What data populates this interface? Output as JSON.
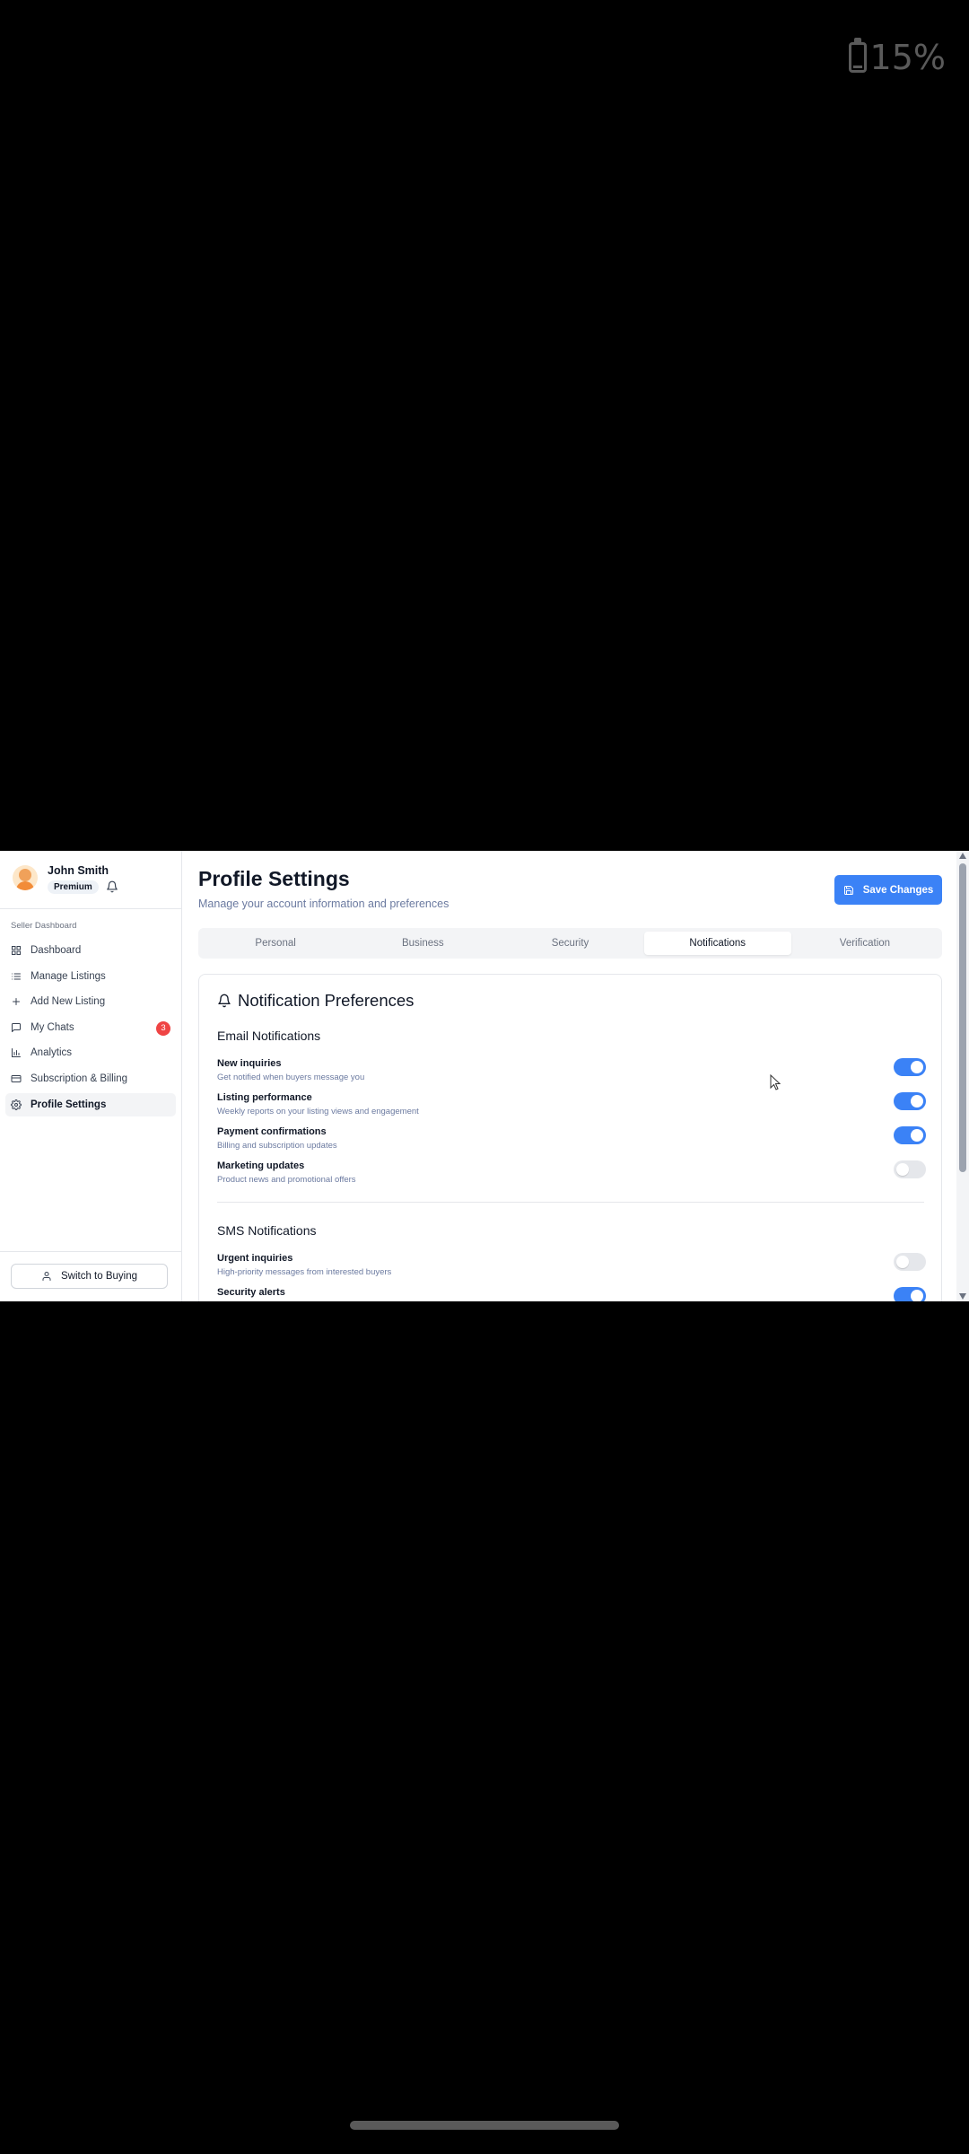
{
  "status_bar": {
    "battery_percent": "15%"
  },
  "user": {
    "name": "John Smith",
    "plan": "Premium"
  },
  "sidebar": {
    "section_label": "Seller Dashboard",
    "items": [
      {
        "label": "Dashboard",
        "icon": "grid-icon"
      },
      {
        "label": "Manage Listings",
        "icon": "list-icon"
      },
      {
        "label": "Add New Listing",
        "icon": "plus-icon"
      },
      {
        "label": "My Chats",
        "icon": "chat-icon",
        "badge": "3"
      },
      {
        "label": "Analytics",
        "icon": "bar-chart-icon"
      },
      {
        "label": "Subscription & Billing",
        "icon": "credit-card-icon"
      },
      {
        "label": "Profile Settings",
        "icon": "gear-icon",
        "active": true
      }
    ],
    "switch_label": "Switch to Buying"
  },
  "header": {
    "title": "Profile Settings",
    "subtitle": "Manage your account information and preferences",
    "save_label": "Save Changes"
  },
  "tabs": [
    {
      "label": "Personal"
    },
    {
      "label": "Business"
    },
    {
      "label": "Security"
    },
    {
      "label": "Notifications",
      "active": true
    },
    {
      "label": "Verification"
    }
  ],
  "notifications": {
    "title": "Notification Preferences",
    "email": {
      "title": "Email Notifications",
      "items": [
        {
          "label": "New inquiries",
          "desc": "Get notified when buyers message you",
          "enabled": true
        },
        {
          "label": "Listing performance",
          "desc": "Weekly reports on your listing views and engagement",
          "enabled": true
        },
        {
          "label": "Payment confirmations",
          "desc": "Billing and subscription updates",
          "enabled": true
        },
        {
          "label": "Marketing updates",
          "desc": "Product news and promotional offers",
          "enabled": false
        }
      ]
    },
    "sms": {
      "title": "SMS Notifications",
      "items": [
        {
          "label": "Urgent inquiries",
          "desc": "High-priority messages from interested buyers",
          "enabled": false
        },
        {
          "label": "Security alerts",
          "desc": "",
          "enabled": true
        }
      ]
    }
  },
  "colors": {
    "accent": "#3b82f6",
    "badge": "#ef4444"
  }
}
